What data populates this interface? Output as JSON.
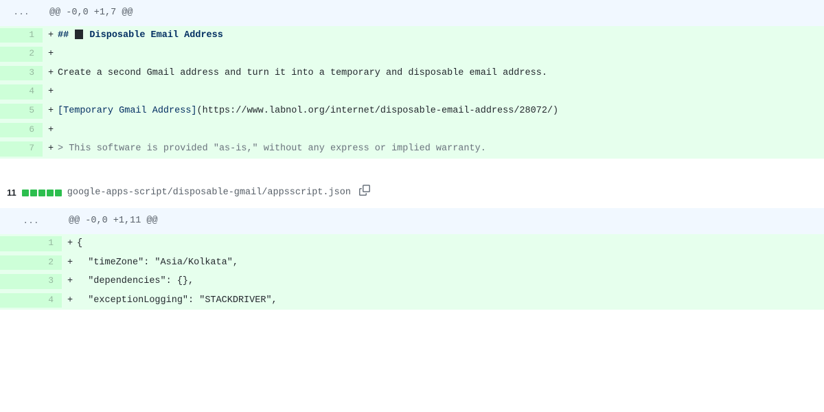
{
  "file1": {
    "hunk": "@@ -0,0 +1,7 @@",
    "lines": [
      {
        "n": 1,
        "marker": "+",
        "type": "heading",
        "prefix": "## ",
        "text": "Disposable Email Address"
      },
      {
        "n": 2,
        "marker": "+",
        "type": "plain",
        "text": ""
      },
      {
        "n": 3,
        "marker": "+",
        "type": "plain",
        "text": "Create a second Gmail address and turn it into a temporary and disposable email address."
      },
      {
        "n": 4,
        "marker": "+",
        "type": "plain",
        "text": ""
      },
      {
        "n": 5,
        "marker": "+",
        "type": "link",
        "linkText": "[Temporary Gmail Address]",
        "url": "(https://www.labnol.org/internet/disposable-email-address/28072/)"
      },
      {
        "n": 6,
        "marker": "+",
        "type": "plain",
        "text": ""
      },
      {
        "n": 7,
        "marker": "+",
        "type": "quote",
        "marker2": "> ",
        "text": "This software is provided \"as-is,\" without any express or implied warranty."
      }
    ]
  },
  "file2": {
    "changeCount": "11",
    "diffstatAdded": 5,
    "path": "google-apps-script/disposable-gmail/appsscript.json",
    "hunk": "@@ -0,0 +1,11 @@",
    "lines": [
      {
        "n": 1,
        "marker": "+",
        "text": "{"
      },
      {
        "n": 2,
        "marker": "+",
        "text": "  \"timeZone\": \"Asia/Kolkata\","
      },
      {
        "n": 3,
        "marker": "+",
        "text": "  \"dependencies\": {},"
      },
      {
        "n": 4,
        "marker": "+",
        "text": "  \"exceptionLogging\": \"STACKDRIVER\","
      }
    ]
  },
  "ellipsis": "..."
}
